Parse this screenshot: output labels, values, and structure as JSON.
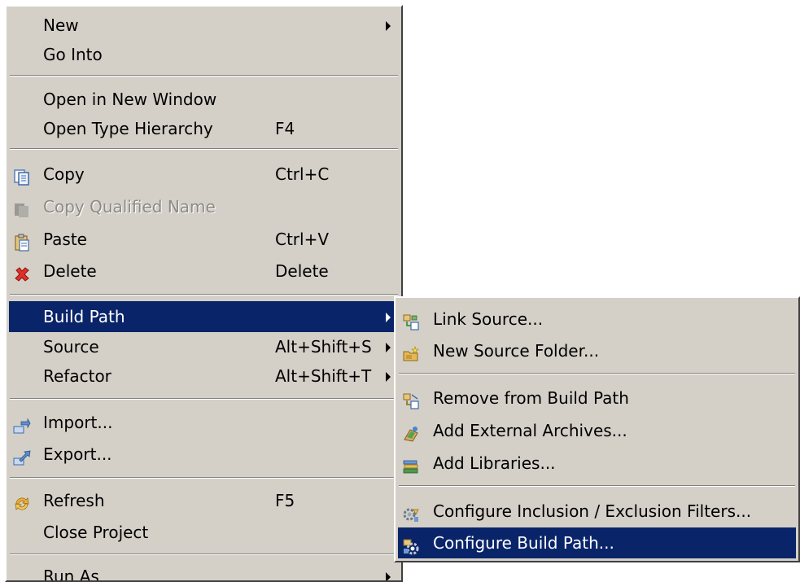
{
  "main_menu": {
    "items": [
      {
        "label": "New",
        "has_submenu": true
      },
      {
        "label": "Go Into"
      },
      {
        "label": "Open in New Window"
      },
      {
        "label": "Open Type Hierarchy",
        "accel": "F4"
      },
      {
        "label": "Copy",
        "accel": "Ctrl+C",
        "icon": "copy-icon"
      },
      {
        "label": "Copy Qualified Name",
        "disabled": true,
        "icon": "copy-qualified-name-icon"
      },
      {
        "label": "Paste",
        "accel": "Ctrl+V",
        "icon": "paste-icon"
      },
      {
        "label": "Delete",
        "accel": "Delete",
        "icon": "delete-icon"
      },
      {
        "label": "Build Path",
        "has_submenu": true,
        "selected": true
      },
      {
        "label": "Source",
        "accel": "Alt+Shift+S",
        "has_submenu": true
      },
      {
        "label": "Refactor",
        "accel": "Alt+Shift+T",
        "has_submenu": true
      },
      {
        "label": "Import...",
        "icon": "import-icon"
      },
      {
        "label": "Export...",
        "icon": "export-icon"
      },
      {
        "label": "Refresh",
        "accel": "F5",
        "icon": "refresh-icon"
      },
      {
        "label": "Close Project"
      },
      {
        "label": "Run As",
        "has_submenu": true
      }
    ]
  },
  "build_path_submenu": {
    "items": [
      {
        "label": "Link Source...",
        "icon": "link-source-icon"
      },
      {
        "label": "New Source Folder...",
        "icon": "new-source-folder-icon"
      },
      {
        "label": "Remove from Build Path",
        "icon": "remove-build-path-icon"
      },
      {
        "label": "Add External Archives...",
        "icon": "add-external-archives-icon"
      },
      {
        "label": "Add Libraries...",
        "icon": "add-libraries-icon"
      },
      {
        "label": "Configure Inclusion / Exclusion Filters...",
        "icon": "configure-filters-icon"
      },
      {
        "label": "Configure Build Path...",
        "icon": "configure-build-path-icon",
        "selected": true
      }
    ]
  },
  "colors": {
    "menu_background": "#d4d0c8",
    "selection_background": "#0a246a",
    "selection_text": "#ffffff",
    "disabled_text": "#8c8a84"
  }
}
